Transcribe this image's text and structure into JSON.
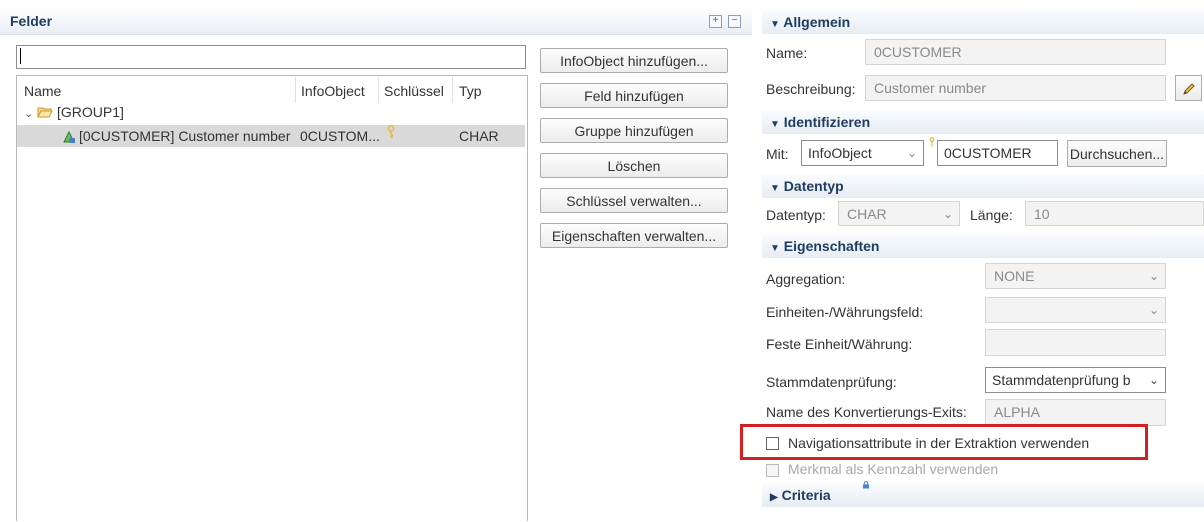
{
  "left_panel": {
    "title": "Felder",
    "filter_value": "",
    "columns": [
      "Name",
      "InfoObject",
      "Schlüssel",
      "Typ"
    ],
    "group_label": "[GROUP1]",
    "row": {
      "name": "[0CUSTOMER] Customer number",
      "infoobject": "0CUSTOM...",
      "typ": "CHAR"
    },
    "buttons": [
      "InfoObject hinzufügen...",
      "Feld hinzufügen",
      "Gruppe hinzufügen",
      "Löschen",
      "Schlüssel verwalten...",
      "Eigenschaften verwalten..."
    ]
  },
  "allgemein": {
    "title": "Allgemein",
    "name_label": "Name:",
    "name_value": "0CUSTOMER",
    "beschreibung_label": "Beschreibung:",
    "beschreibung_value": "Customer number"
  },
  "identifizieren": {
    "title": "Identifizieren",
    "mit_label": "Mit:",
    "mit_value": "InfoObject",
    "object_value": "0CUSTOMER",
    "durchsuchen_label": "Durchsuchen..."
  },
  "datentyp": {
    "title": "Datentyp",
    "datentyp_label": "Datentyp:",
    "datentyp_value": "CHAR",
    "laenge_label": "Länge:",
    "laenge_value": "10"
  },
  "eigenschaften": {
    "title": "Eigenschaften",
    "aggregation_label": "Aggregation:",
    "aggregation_value": "NONE",
    "einheiten_label": "Einheiten-/Währungsfeld:",
    "einheiten_value": "",
    "feste_label": "Feste Einheit/Währung:",
    "feste_value": "",
    "stammdaten_label": "Stammdatenprüfung:",
    "stammdaten_value": "Stammdatenprüfung b",
    "konv_label": "Name des Konvertierungs-Exits:",
    "konv_value": "ALPHA",
    "nav_checkbox_label": "Navigationsattribute in der Extraktion verwenden",
    "nav_checked": false,
    "merkmal_checkbox_label": "Merkmal als Kennzahl verwenden",
    "merkmal_checked": false
  },
  "criteria": {
    "title": "Criteria"
  },
  "colors": {
    "section_title": "#1f3c64",
    "highlight_border": "#d21f1f",
    "selected_row": "#d9d9d9"
  }
}
